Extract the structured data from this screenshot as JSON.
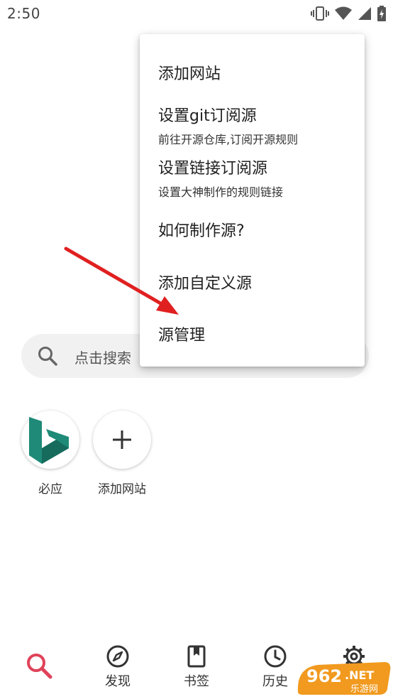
{
  "status_bar": {
    "time": "2:50",
    "icons": [
      "vibrate-icon",
      "wifi-icon",
      "signal-icon",
      "battery-charging-icon"
    ]
  },
  "search": {
    "placeholder": "点击搜索"
  },
  "quick_sites": [
    {
      "label": "必应",
      "icon": "bing-logo",
      "color": "#1f8a78"
    },
    {
      "label": "添加网站",
      "icon": "plus-icon"
    }
  ],
  "menu": {
    "items": [
      {
        "title": "添加网站",
        "subtitle": ""
      },
      {
        "title": "设置git订阅源",
        "subtitle": "前往开源仓库,订阅开源规则"
      },
      {
        "title": "设置链接订阅源",
        "subtitle": "设置大神制作的规则链接"
      },
      {
        "title": "如何制作源?",
        "subtitle": ""
      },
      {
        "title": "添加自定义源",
        "subtitle": ""
      },
      {
        "title": "源管理",
        "subtitle": ""
      }
    ]
  },
  "annotation": {
    "arrow_color": "#e02020"
  },
  "bottom_nav": {
    "items": [
      {
        "label": "",
        "icon": "search-icon",
        "active": true
      },
      {
        "label": "发现",
        "icon": "compass-icon"
      },
      {
        "label": "书签",
        "icon": "bookmark-icon"
      },
      {
        "label": "历史",
        "icon": "clock-icon"
      },
      {
        "label": "设置",
        "icon": "gear-icon"
      }
    ],
    "active_color": "#e0435a"
  },
  "watermark": {
    "text": "962.NET",
    "subtext": "乐游网"
  }
}
